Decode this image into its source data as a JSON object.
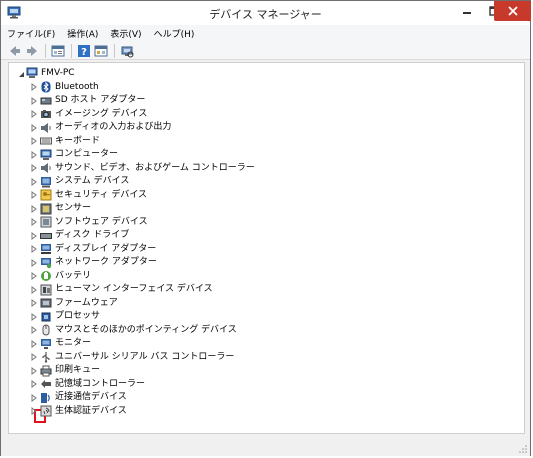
{
  "window": {
    "title": "デバイス マネージャー"
  },
  "menu": [
    {
      "label": "ファイル(F)"
    },
    {
      "label": "操作(A)"
    },
    {
      "label": "表示(V)"
    },
    {
      "label": "ヘルプ(H)"
    }
  ],
  "toolbar": {
    "icons": [
      "back-icon",
      "forward-icon",
      "properties-icon",
      "help-icon",
      "show-hidden-icon",
      "scan-hardware-icon"
    ]
  },
  "tree": {
    "root": {
      "label": "FMV-PC",
      "icon": "computer-icon",
      "expanded": true
    },
    "items": [
      {
        "label": "Bluetooth",
        "icon": "bluetooth-icon"
      },
      {
        "label": "SD ホスト アダプター",
        "icon": "sd-host-icon"
      },
      {
        "label": "イメージング デバイス",
        "icon": "camera-icon"
      },
      {
        "label": "オーディオの入力および出力",
        "icon": "speaker-icon"
      },
      {
        "label": "キーボード",
        "icon": "keyboard-icon"
      },
      {
        "label": "コンピューター",
        "icon": "computer-icon"
      },
      {
        "label": "サウンド、ビデオ、およびゲーム コントローラー",
        "icon": "speaker-icon"
      },
      {
        "label": "システム デバイス",
        "icon": "system-icon"
      },
      {
        "label": "セキュリティ デバイス",
        "icon": "security-key-icon"
      },
      {
        "label": "センサー",
        "icon": "sensor-icon"
      },
      {
        "label": "ソフトウェア デバイス",
        "icon": "software-device-icon"
      },
      {
        "label": "ディスク ドライブ",
        "icon": "disk-drive-icon"
      },
      {
        "label": "ディスプレイ アダプター",
        "icon": "display-adapter-icon"
      },
      {
        "label": "ネットワーク アダプター",
        "icon": "network-adapter-icon"
      },
      {
        "label": "バッテリ",
        "icon": "battery-icon"
      },
      {
        "label": "ヒューマン インターフェイス デバイス",
        "icon": "hid-icon"
      },
      {
        "label": "ファームウェア",
        "icon": "firmware-icon"
      },
      {
        "label": "プロセッサ",
        "icon": "processor-icon"
      },
      {
        "label": "マウスとそのほかのポインティング デバイス",
        "icon": "mouse-icon"
      },
      {
        "label": "モニター",
        "icon": "monitor-icon"
      },
      {
        "label": "ユニバーサル シリアル バス コントローラー",
        "icon": "usb-icon",
        "highlighted": true
      },
      {
        "label": "印刷キュー",
        "icon": "printer-icon"
      },
      {
        "label": "記憶域コントローラー",
        "icon": "storage-controller-icon"
      },
      {
        "label": "近接通信デバイス",
        "icon": "proximity-icon"
      },
      {
        "label": "生体認証デバイス",
        "icon": "biometric-icon"
      }
    ]
  },
  "colors": {
    "close_button": "#c7392b",
    "highlight_box": "#e0131a"
  }
}
